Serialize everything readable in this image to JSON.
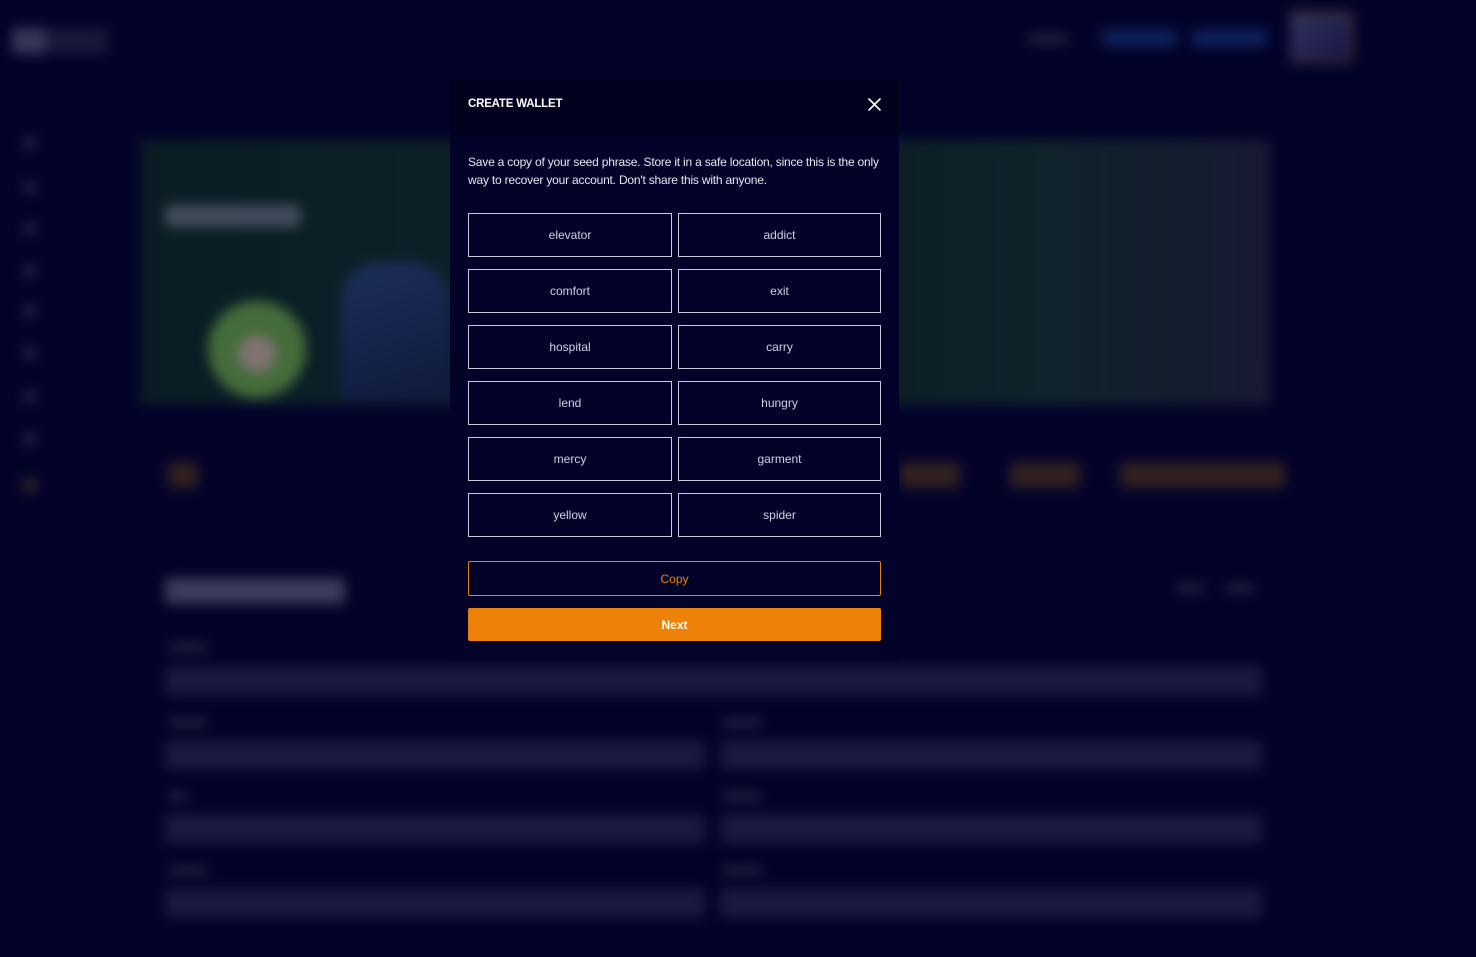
{
  "modal": {
    "title": "CREATE WALLET",
    "close_icon": "close-icon",
    "description": "Save a copy of your seed phrase. Store it in a safe location, since this is the only way to recover your account. Don't share this with anyone.",
    "seed_words": [
      "elevator",
      "addict",
      "comfort",
      "exit",
      "hospital",
      "carry",
      "lend",
      "hungry",
      "mercy",
      "garment",
      "yellow",
      "spider"
    ],
    "copy_label": "Copy",
    "next_label": "Next"
  },
  "colors": {
    "background": "#03032a",
    "modal_header": "#02021f",
    "accent_orange": "#ee8209",
    "word_border": "#c9c9d9"
  }
}
